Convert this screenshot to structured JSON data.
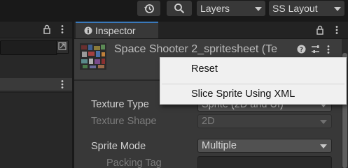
{
  "toolbar": {
    "history_icon": "history-icon",
    "search_icon": "search-icon",
    "layers_label": "Layers",
    "layout_label": "SS Layout"
  },
  "left_panel": {
    "lock_icon": "lock-icon",
    "menu_icon": "kebab-menu-icon",
    "picker_icon": "object-picker-icon"
  },
  "inspector": {
    "tab_label": "Inspector",
    "tab_icon": "info-icon",
    "asset_title": "Space Shooter 2_spritesheet (Te",
    "header_icons": [
      "help-icon",
      "preset-icon",
      "kebab-menu-icon"
    ],
    "properties": [
      {
        "label": "Texture Type",
        "value": "Sprite (2D and UI)",
        "enabled": true
      },
      {
        "label": "Texture Shape",
        "value": "2D",
        "enabled": false
      },
      {
        "label": "Sprite Mode",
        "value": "Multiple",
        "enabled": true
      },
      {
        "label": "Packing Tag",
        "value": "",
        "enabled": false
      }
    ]
  },
  "context_menu": {
    "items": [
      "Reset",
      "Slice Sprite Using XML"
    ]
  },
  "colors": {
    "accent_tab": "#3a79bb",
    "panel_bg": "#282828",
    "field_bg": "#515151",
    "menu_bg": "#f0f0f0"
  }
}
